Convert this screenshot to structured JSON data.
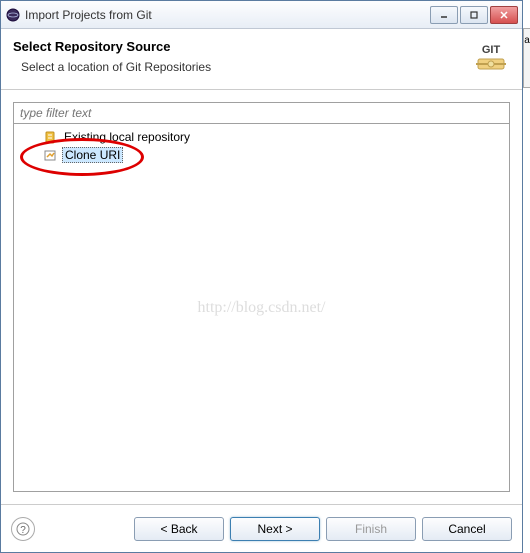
{
  "titlebar": {
    "text": "Import Projects from Git"
  },
  "header": {
    "title": "Select Repository Source",
    "subtitle": "Select a location of Git Repositories",
    "icon_label": "GIT"
  },
  "filter": {
    "placeholder": "type filter text"
  },
  "tree": {
    "items": [
      {
        "label": "Existing local repository",
        "selected": false
      },
      {
        "label": "Clone URI",
        "selected": true
      }
    ]
  },
  "watermark": "http://blog.csdn.net/",
  "buttons": {
    "back": "< Back",
    "next": "Next >",
    "finish": "Finish",
    "cancel": "Cancel"
  },
  "edge_char": "a"
}
